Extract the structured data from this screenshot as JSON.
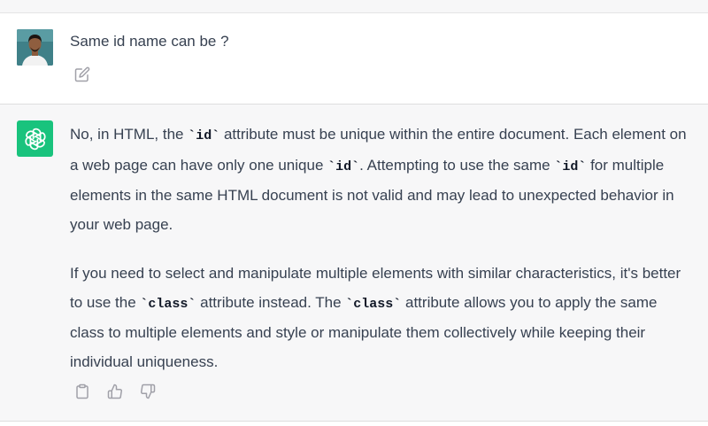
{
  "user": {
    "message": "Same id name can be ?"
  },
  "assistant": {
    "p1": {
      "t1": "No, in HTML, the ",
      "c1": "`id`",
      "t2": " attribute must be unique within the entire document. Each element on a web page can have only one unique ",
      "c2": "`id`",
      "t3": ". Attempting to use the same ",
      "c3": "`id`",
      "t4": " for multiple elements in the same HTML document is not valid and may lead to unexpected behavior in your web page."
    },
    "p2": {
      "t1": "If you need to select and manipulate multiple elements with similar characteristics, it's better to use the ",
      "c1": "`class`",
      "t2": " attribute instead. The ",
      "c2": "`class`",
      "t3": " attribute allows you to apply the same class to multiple elements and style or manipulate them collectively while keeping their individual uniqueness."
    }
  },
  "icons": {
    "user_avatar": "user-avatar",
    "bot_avatar": "openai-logo-icon",
    "edit": "pencil-square-icon",
    "copy": "clipboard-icon",
    "thumbs_up": "thumbs-up-icon",
    "thumbs_down": "thumbs-down-icon"
  },
  "colors": {
    "bot_avatar_bg": "#19c37d",
    "user_row_bg": "#ffffff",
    "assistant_row_bg": "#f7f7f8",
    "text": "#374151",
    "icon": "#a0a0a8"
  }
}
